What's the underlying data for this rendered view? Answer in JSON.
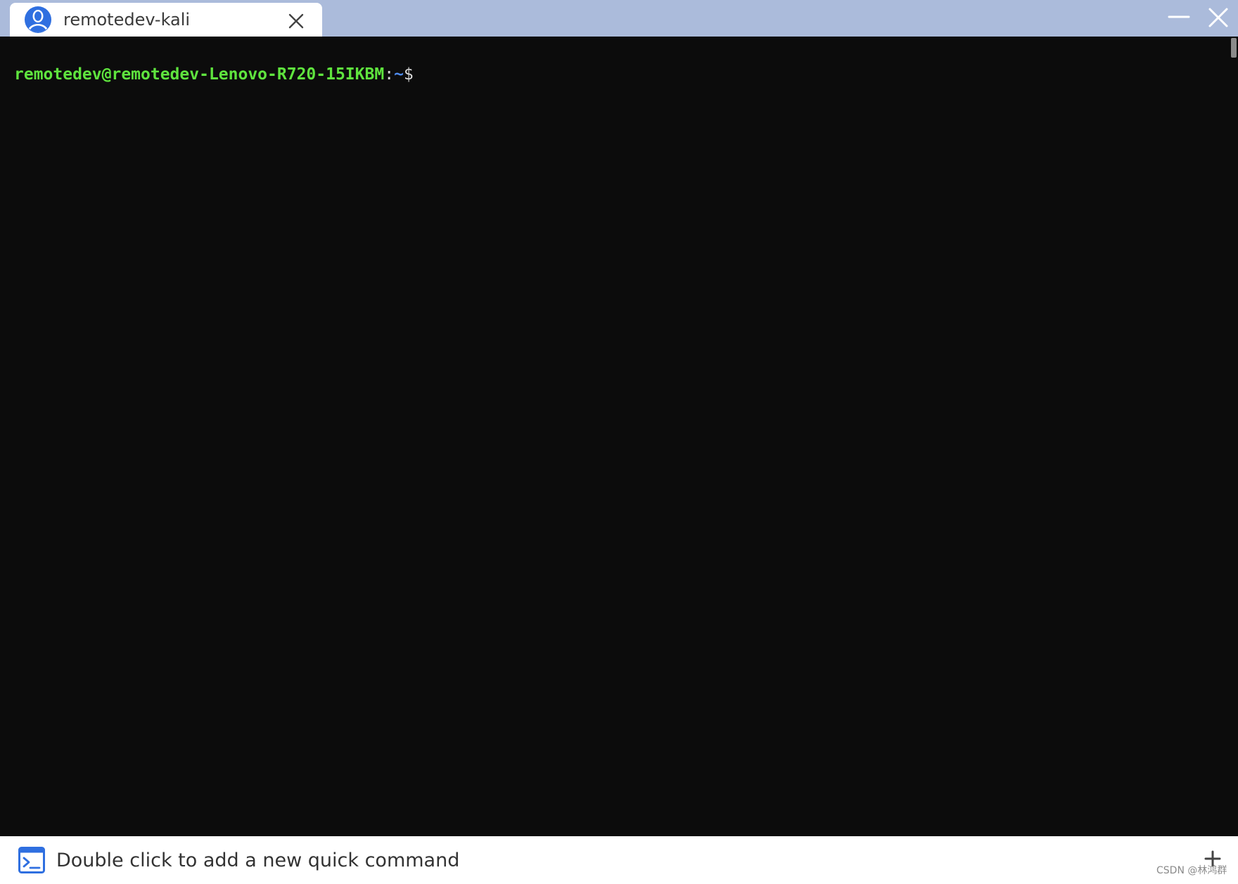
{
  "window": {
    "tab_title": "remotedev-kali"
  },
  "icons": {
    "tab_avatar": "user-avatar-icon",
    "tab_close": "close-icon",
    "minimize": "minimize-icon",
    "close": "close-icon",
    "quick_command": "terminal-icon",
    "add": "plus-icon"
  },
  "terminal": {
    "prompt_user_host": "remotedev@remotedev-Lenovo-R720-15IKBM",
    "prompt_colon": ":",
    "prompt_path": "~",
    "prompt_symbol": "$"
  },
  "quick_command_bar": {
    "hint": "Double click to add a new quick command"
  },
  "watermark": "CSDN @林鸿群",
  "colors": {
    "titlebar": "#abbbdb",
    "terminal_bg": "#0c0c0c",
    "prompt_user": "#5fe43e",
    "prompt_path": "#4f8cf0",
    "accent_blue": "#2f6fe0"
  }
}
